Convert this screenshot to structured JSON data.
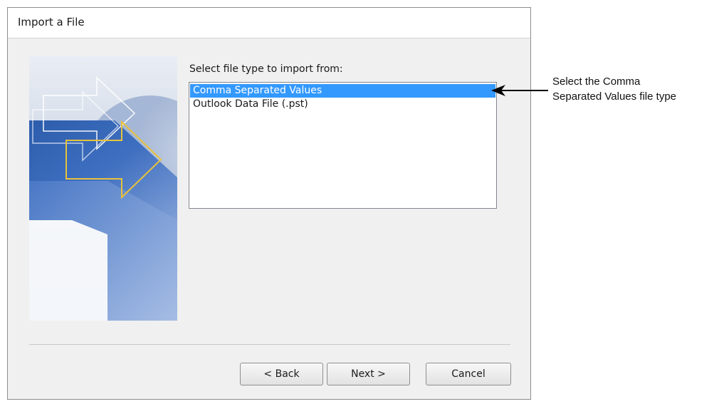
{
  "dialog": {
    "title": "Import a File",
    "prompt": "Select file type to import from:",
    "file_types": [
      {
        "label": "Comma Separated Values",
        "selected": true
      },
      {
        "label": "Outlook Data File (.pst)",
        "selected": false
      }
    ],
    "buttons": {
      "back": "< Back",
      "next": "Next >",
      "cancel": "Cancel"
    },
    "selection_color": "#3399ff"
  },
  "annotation": {
    "line1": "Select the Comma",
    "line2": "Separated Values file type",
    "arrow_icon": "left-arrow-icon"
  }
}
